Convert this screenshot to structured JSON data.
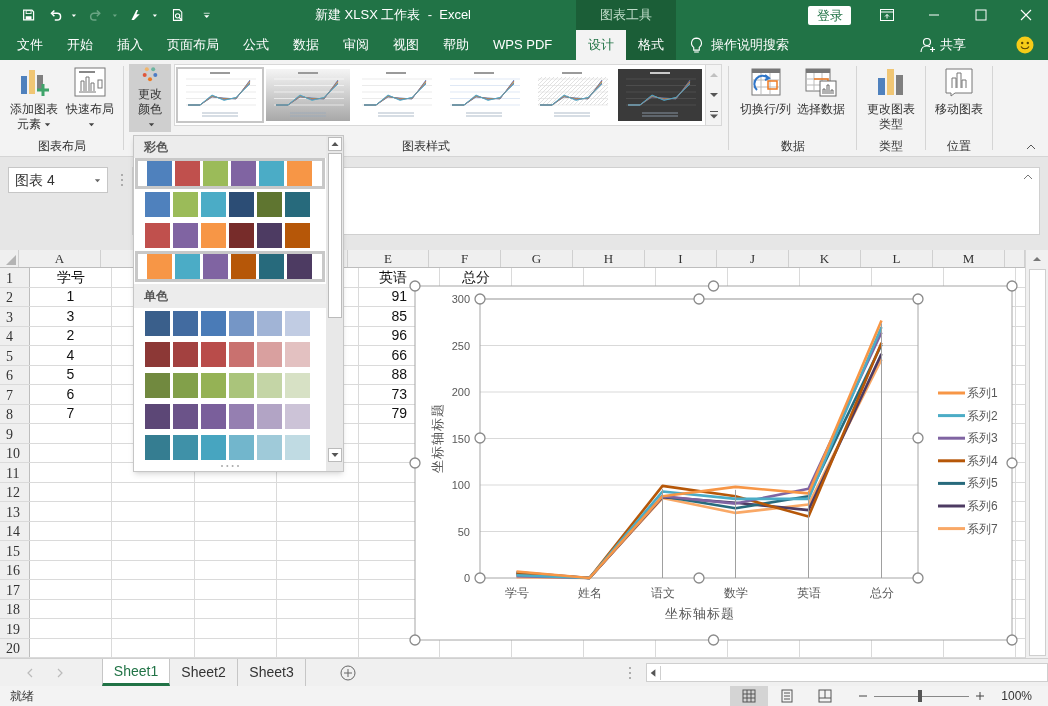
{
  "window": {
    "title": "新建 XLSX 工作表  -  Excel",
    "context_tab_group": "图表工具",
    "sign_in": "登录"
  },
  "tabs": [
    {
      "label": "文件",
      "selected": false,
      "contextual": false
    },
    {
      "label": "开始",
      "selected": false,
      "contextual": false
    },
    {
      "label": "插入",
      "selected": false,
      "contextual": false
    },
    {
      "label": "页面布局",
      "selected": false,
      "contextual": false
    },
    {
      "label": "公式",
      "selected": false,
      "contextual": false
    },
    {
      "label": "数据",
      "selected": false,
      "contextual": false
    },
    {
      "label": "审阅",
      "selected": false,
      "contextual": false
    },
    {
      "label": "视图",
      "selected": false,
      "contextual": false
    },
    {
      "label": "帮助",
      "selected": false,
      "contextual": false
    },
    {
      "label": "WPS PDF",
      "selected": false,
      "contextual": false
    },
    {
      "label": "设计",
      "selected": true,
      "contextual": true
    },
    {
      "label": "格式",
      "selected": false,
      "contextual": true
    }
  ],
  "tell_me": "操作说明搜索",
  "share": "共享",
  "ribbon": {
    "chart_layouts": {
      "label": "图表布局",
      "buttons": [
        {
          "label": "添加图表元素",
          "dropdown": true
        },
        {
          "label": "快速布局",
          "dropdown": true
        }
      ]
    },
    "chart_styles": {
      "label": "图表样式",
      "change_colors": {
        "label": "更改颜色",
        "dropdown": true,
        "pressed": true
      },
      "styles": [
        {
          "kind": "white",
          "selected": true
        },
        {
          "kind": "gradient",
          "selected": false
        },
        {
          "kind": "white",
          "selected": false
        },
        {
          "kind": "blue",
          "selected": false
        },
        {
          "kind": "hatched",
          "selected": false
        },
        {
          "kind": "dark",
          "selected": false
        }
      ]
    },
    "data": {
      "label": "数据",
      "buttons": [
        "切换行/列",
        "选择数据"
      ]
    },
    "type": {
      "label": "类型",
      "button": "更改图表类型"
    },
    "location": {
      "label": "位置",
      "button": "移动图表"
    }
  },
  "name_box": "图表 4",
  "color_menu": {
    "sections": [
      {
        "title": "彩色",
        "rows": [
          {
            "highlighted": true,
            "swatches": [
              {
                "color": "#4f81bd"
              },
              {
                "color": "#c0504d"
              },
              {
                "color": "#9bbb59"
              },
              {
                "color": "#8064a2"
              },
              {
                "color": "#4bacc6"
              },
              {
                "color": "#f79646"
              }
            ]
          },
          {
            "highlighted": false,
            "swatches": [
              {
                "color": "#4f81bd"
              },
              {
                "color": "#9bbb59"
              },
              {
                "color": "#4bacc6"
              },
              {
                "color": "#2c4d75"
              },
              {
                "color": "#5f7530"
              },
              {
                "color": "#276a7c"
              }
            ]
          },
          {
            "highlighted": false,
            "swatches": [
              {
                "color": "#c0504d"
              },
              {
                "color": "#8064a2"
              },
              {
                "color": "#f79646"
              },
              {
                "color": "#772c2a"
              },
              {
                "color": "#4d3b62"
              },
              {
                "color": "#b65708"
              }
            ]
          },
          {
            "highlighted": true,
            "swatches": [
              {
                "color": "#f79646"
              },
              {
                "color": "#4bacc6"
              },
              {
                "color": "#8064a2"
              },
              {
                "color": "#b65708"
              },
              {
                "color": "#276a7c"
              },
              {
                "color": "#4d3b62"
              }
            ]
          }
        ]
      },
      {
        "title": "单色",
        "rows": [
          {
            "highlighted": false,
            "swatches": [
              {
                "color": "#3a5f8b"
              },
              {
                "color": "#426ba0"
              },
              {
                "color": "#4a7bb7"
              },
              {
                "color": "#7596c6"
              },
              {
                "color": "#a1b4d6"
              },
              {
                "color": "#c1cce3"
              }
            ]
          },
          {
            "highlighted": false,
            "swatches": [
              {
                "color": "#8c3836"
              },
              {
                "color": "#a34140"
              },
              {
                "color": "#b94c4a"
              },
              {
                "color": "#c9716f"
              },
              {
                "color": "#d9a09f"
              },
              {
                "color": "#e3c1c1"
              }
            ]
          },
          {
            "highlighted": false,
            "swatches": [
              {
                "color": "#71893f"
              },
              {
                "color": "#82a04a"
              },
              {
                "color": "#95b255"
              },
              {
                "color": "#aac47b"
              },
              {
                "color": "#c4d5a6"
              },
              {
                "color": "#d7e1c5"
              }
            ]
          },
          {
            "highlighted": false,
            "swatches": [
              {
                "color": "#5c4776"
              },
              {
                "color": "#6b5389"
              },
              {
                "color": "#7a5f9b"
              },
              {
                "color": "#957fb1"
              },
              {
                "color": "#b2a4c5"
              },
              {
                "color": "#ccc3d7"
              }
            ]
          },
          {
            "highlighted": false,
            "swatches": [
              {
                "color": "#357d91"
              },
              {
                "color": "#3f91a8"
              },
              {
                "color": "#47a5c0"
              },
              {
                "color": "#72b6cc"
              },
              {
                "color": "#9fcad9"
              },
              {
                "color": "#c0dbe3"
              }
            ]
          }
        ]
      }
    ]
  },
  "sheet": {
    "column_headers": [
      "A",
      "E",
      "F",
      "G",
      "H",
      "I",
      "J",
      "K",
      "L",
      "M"
    ],
    "rows": [
      {
        "number": "1",
        "col_a": "学号",
        "col_e": "英语",
        "col_f": "总分"
      },
      {
        "number": "2",
        "col_a": "1",
        "col_e": "91"
      },
      {
        "number": "3",
        "col_a": "3",
        "col_e": "85"
      },
      {
        "number": "4",
        "col_a": "2",
        "col_e": "96"
      },
      {
        "number": "5",
        "col_a": "4",
        "col_e": "66"
      },
      {
        "number": "6",
        "col_a": "5",
        "col_e": "88"
      },
      {
        "number": "7",
        "col_a": "6",
        "col_e": "73"
      },
      {
        "number": "8",
        "col_a": "7",
        "col_e": "79"
      },
      {
        "number": "9"
      },
      {
        "number": "10"
      },
      {
        "number": "11"
      },
      {
        "number": "12"
      },
      {
        "number": "13"
      },
      {
        "number": "14"
      },
      {
        "number": "15"
      },
      {
        "number": "16"
      },
      {
        "number": "17"
      },
      {
        "number": "18"
      },
      {
        "number": "19"
      },
      {
        "number": "20"
      }
    ]
  },
  "chart": {
    "chart_data": {
      "type": "line",
      "xlabel": "坐标轴标题",
      "ylabel": "坐标轴标题",
      "categories": [
        "学号",
        "姓名",
        "语文",
        "数学",
        "英语",
        "总分"
      ],
      "ylim": [
        0,
        300
      ],
      "yticks": [
        0,
        50,
        100,
        150,
        200,
        250,
        300
      ],
      "grid": true,
      "legend": "right",
      "series": [
        {
          "name": "系列1",
          "color": "#f79646",
          "values": [
            7,
            0,
            88,
            98,
            91,
            277
          ]
        },
        {
          "name": "系列2",
          "color": "#4bacc6",
          "values": [
            3,
            0,
            93,
            85,
            85,
            270
          ]
        },
        {
          "name": "系列3",
          "color": "#8064a2",
          "values": [
            2,
            0,
            88,
            80,
            96,
            264
          ]
        },
        {
          "name": "系列4",
          "color": "#b65708",
          "values": [
            4,
            0,
            99,
            88,
            66,
            253
          ]
        },
        {
          "name": "系列5",
          "color": "#276a7c",
          "values": [
            5,
            0,
            88,
            75,
            88,
            251
          ]
        },
        {
          "name": "系列6",
          "color": "#4d3b62",
          "values": [
            6,
            0,
            87,
            81,
            73,
            241
          ]
        },
        {
          "name": "系列7",
          "color": "#f9a866",
          "values": [
            1,
            0,
            86,
            70,
            79,
            235
          ]
        }
      ]
    }
  },
  "sheet_tabs": [
    {
      "label": "Sheet1",
      "selected": true
    },
    {
      "label": "Sheet2",
      "selected": false
    },
    {
      "label": "Sheet3",
      "selected": false
    }
  ],
  "status": "就绪",
  "views": [
    {
      "kind": "normal",
      "selected": true
    },
    {
      "kind": "page_layout",
      "selected": false
    },
    {
      "kind": "page_break",
      "selected": false
    }
  ],
  "zoom": {
    "level": 0.48,
    "reading": "100%"
  }
}
